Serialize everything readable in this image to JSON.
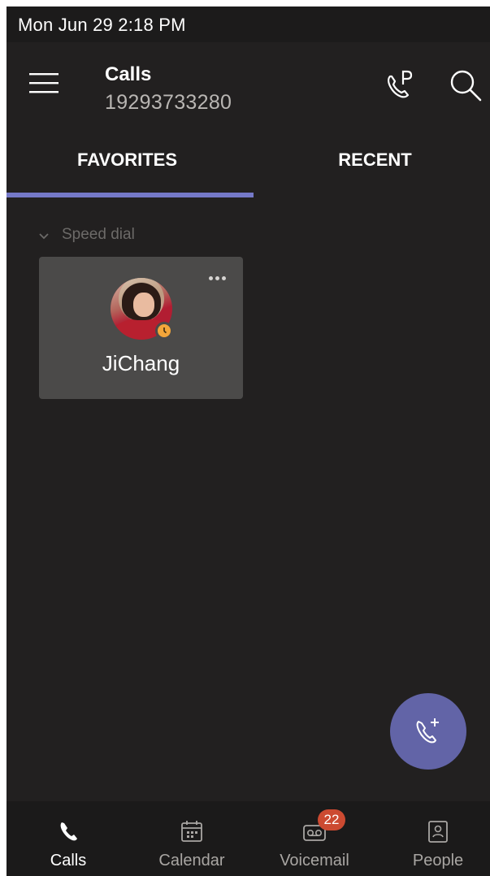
{
  "status_bar": {
    "time": "Mon Jun 29  2:18 PM"
  },
  "header": {
    "title": "Calls",
    "subtitle": "19293733280"
  },
  "icons": {
    "menu": "hamburger-icon",
    "park": "call-park-icon",
    "search": "search-icon",
    "fab": "dial-pad-call-icon"
  },
  "tabs": [
    {
      "label": "FAVORITES",
      "active": true
    },
    {
      "label": "RECENT",
      "active": false
    }
  ],
  "speed_dial": {
    "header": "Speed dial",
    "contacts": [
      {
        "name": "JiChang",
        "presence": "away"
      }
    ]
  },
  "bottom_nav": [
    {
      "label": "Calls",
      "icon": "phone-icon",
      "active": true
    },
    {
      "label": "Calendar",
      "icon": "calendar-icon",
      "active": false
    },
    {
      "label": "Voicemail",
      "icon": "voicemail-icon",
      "active": false,
      "badge": "22"
    },
    {
      "label": "People",
      "icon": "contacts-icon",
      "active": false
    }
  ],
  "colors": {
    "background": "#222020",
    "accent": "#6264a7",
    "tab_indicator": "#7579c8",
    "tile": "#4b4a49",
    "badge": "#cc4a31",
    "presence_away": "#f4a63a"
  }
}
